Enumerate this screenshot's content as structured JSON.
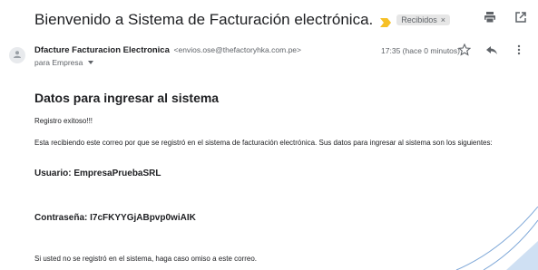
{
  "email": {
    "subject": "Bienvenido a Sistema de Facturación electrónica.",
    "label": "Recibidos",
    "sender_name": "Dfacture Facturacion Electronica",
    "sender_email": "<envios.ose@thefactoryhka.com.pe>",
    "recipient": "para Empresa",
    "timestamp": "17:35 (hace 0 minutos)"
  },
  "body": {
    "title": "Datos para ingresar al sistema",
    "registro": "Registro exitoso!!!",
    "intro": "Esta recibiendo este correo por que se registró en el sistema de facturación electrónica. Sus datos para ingresar al sistema son los siguientes:",
    "usuario": "Usuario: EmpresaPruebaSRL",
    "contrasena": "Contraseña: I7cFKYYGjABpvp0wiAIK",
    "footer": "Si usted no se registró en el sistema, haga caso omiso a este correo."
  },
  "icons": {
    "importance": "importance-marker-icon",
    "label_remove": "close-icon",
    "print": "print-icon",
    "new_window": "open-in-new-window-icon",
    "avatar": "person-icon",
    "star": "star-icon",
    "reply": "reply-icon",
    "more": "more-vert-icon"
  },
  "colors": {
    "importance": "#f6c026",
    "deco": "#7fa8d8"
  }
}
